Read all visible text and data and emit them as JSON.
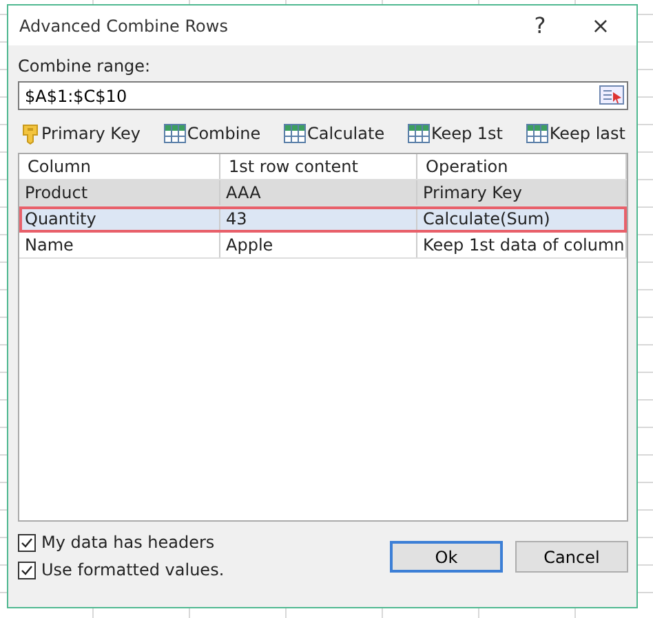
{
  "window": {
    "title": "Advanced Combine Rows",
    "help": "?",
    "close": "×"
  },
  "range": {
    "label": "Combine range:",
    "value": "$A$1:$C$10"
  },
  "toolbar": [
    {
      "label": "Primary Key",
      "kind": "key"
    },
    {
      "label": "Combine",
      "kind": "table"
    },
    {
      "label": "Calculate",
      "kind": "table"
    },
    {
      "label": "Keep 1st",
      "kind": "table"
    },
    {
      "label": "Keep last",
      "kind": "table"
    }
  ],
  "table": {
    "columns": [
      "Column",
      "1st row content",
      "Operation"
    ],
    "rows": [
      {
        "cells": [
          "Product",
          "AAA",
          "Primary Key"
        ],
        "kind": "key",
        "selected": false,
        "annotated": false
      },
      {
        "cells": [
          "Quantity",
          "43",
          "Calculate(Sum)"
        ],
        "kind": "normal",
        "selected": true,
        "annotated": true
      },
      {
        "cells": [
          "Name",
          "Apple",
          "Keep 1st data of column"
        ],
        "kind": "normal",
        "selected": false,
        "annotated": false
      }
    ]
  },
  "options": [
    {
      "label": "My data has headers",
      "checked": true
    },
    {
      "label": "Use formatted values.",
      "checked": true
    }
  ],
  "buttons": [
    {
      "label": "Ok",
      "default": true
    },
    {
      "label": "Cancel",
      "default": false
    }
  ]
}
